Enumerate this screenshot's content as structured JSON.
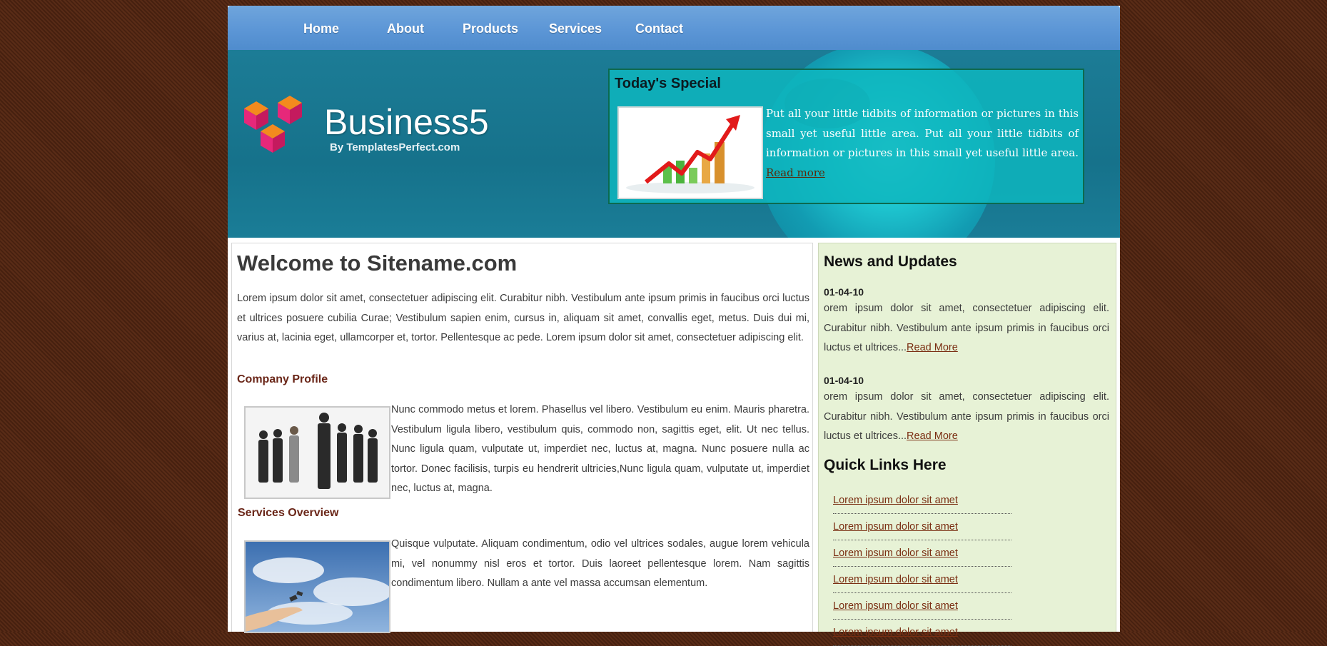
{
  "nav": {
    "items": [
      "Home",
      "About",
      "Products",
      "Services",
      "Contact"
    ]
  },
  "header": {
    "brand": "Business5",
    "byline": "By TemplatesPerfect.com",
    "special": {
      "title": "Today's Special",
      "text": "Put all your little tidbits of information or pictures in this small yet useful little area. Put all your little tidbits of information or pictures in this small yet useful little area.",
      "link": "Read more"
    }
  },
  "main": {
    "title": "Welcome to Sitename.com",
    "intro": "Lorem ipsum dolor sit amet, consectetuer adipiscing elit. Curabitur nibh. Vestibulum ante ipsum primis in faucibus orci luctus et ultrices posuere cubilia Curae; Vestibulum sapien enim, cursus in, aliquam sit amet, convallis eget, metus. Duis dui mi, varius at, lacinia eget, ullamcorper et, tortor. Pellentesque ac pede. Lorem ipsum dolor sit amet, consectetuer adipiscing elit.",
    "profile_heading": "Company Profile",
    "profile_text": "Nunc commodo metus et lorem. Phasellus vel libero. Vestibulum eu enim. Mauris pharetra. Vestibulum ligula libero, vestibulum quis, commodo non, sagittis eget, elit. Ut nec tellus. Nunc ligula quam, vulputate ut, imperdiet nec, luctus at, magna. Nunc posuere nulla ac tortor. Donec facilisis, turpis eu hendrerit ultricies,Nunc ligula quam, vulputate ut, imperdiet nec, luctus at, magna.",
    "services_heading": "Services Overview",
    "services_text": "Quisque vulputate. Aliquam condimentum, odio vel ultrices sodales, augue lorem vehicula mi, vel nonummy nisl eros et tortor. Duis laoreet pellentesque lorem. Nam sagittis condimentum libero. Nullam a ante vel massa accumsan elementum."
  },
  "sidebar": {
    "news_title": "News and Updates",
    "news": [
      {
        "date": "01-04-10",
        "text": "orem ipsum dolor sit amet, consectetuer adipiscing elit. Curabitur nibh. Vestibulum ante ipsum primis in faucibus orci luctus et ultrices...",
        "link": "Read More"
      },
      {
        "date": "01-04-10",
        "text": "orem ipsum dolor sit amet, consectetuer adipiscing elit. Curabitur nibh. Vestibulum ante ipsum primis in faucibus orci luctus et ultrices...",
        "link": "Read More"
      }
    ],
    "links_title": "Quick Links Here",
    "links": [
      "Lorem ipsum dolor sit amet",
      "Lorem ipsum dolor sit amet",
      "Lorem ipsum dolor sit amet",
      "Lorem ipsum dolor sit amet",
      "Lorem ipsum dolor sit amet",
      "Lorem ipsum dolor sit amet"
    ]
  },
  "colors": {
    "background": "#4a2312",
    "nav": "#5c96d6",
    "header": "#16728b",
    "special_box": "#0eb6be",
    "sidebar": "#e7f2d6",
    "link": "#7a2e12"
  }
}
